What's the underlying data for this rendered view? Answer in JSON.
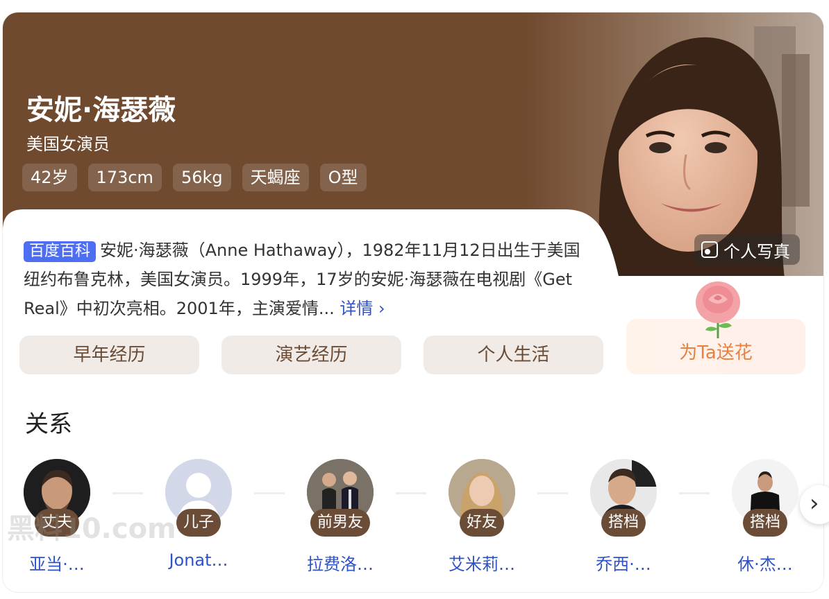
{
  "profile": {
    "name": "安妮·海瑟薇",
    "subtitle": "美国女演员",
    "tags": [
      "42岁",
      "173cm",
      "56kg",
      "天蝎座",
      "O型"
    ]
  },
  "summary": {
    "badge": "百度百科",
    "text": "安妮·海瑟薇（Anne Hathaway），1982年11月12日出生于美国纽约布鲁克林，美国女演员。1999年，17岁的安妮·海瑟薇在电视剧《Get Real》中初次亮相。2001年，主演爱情...",
    "more_label": "详情 ›"
  },
  "photo_button": {
    "label": "个人写真",
    "icon": "image-icon"
  },
  "sections": [
    {
      "label": "早年经历"
    },
    {
      "label": "演艺经历"
    },
    {
      "label": "个人生活"
    }
  ],
  "flower": {
    "label": "为Ta送花",
    "icon": "rose-icon"
  },
  "relations": {
    "title": "关系",
    "items": [
      {
        "role": "丈夫",
        "name": "亚当·…"
      },
      {
        "role": "儿子",
        "name": "Jonat…"
      },
      {
        "role": "前男友",
        "name": "拉费洛…"
      },
      {
        "role": "好友",
        "name": "艾米莉…"
      },
      {
        "role": "搭档",
        "name": "乔西·…"
      },
      {
        "role": "搭档",
        "name": "休·杰…"
      }
    ],
    "next_icon": "chevron-right-icon"
  },
  "watermark": "黑料10.com",
  "colors": {
    "hero_bg": "#704a2f",
    "accent_blue": "#4e6ef2",
    "link_blue": "#2e53c7",
    "badge_brown": "#6b4d37",
    "flower_orange": "#e8813d"
  }
}
